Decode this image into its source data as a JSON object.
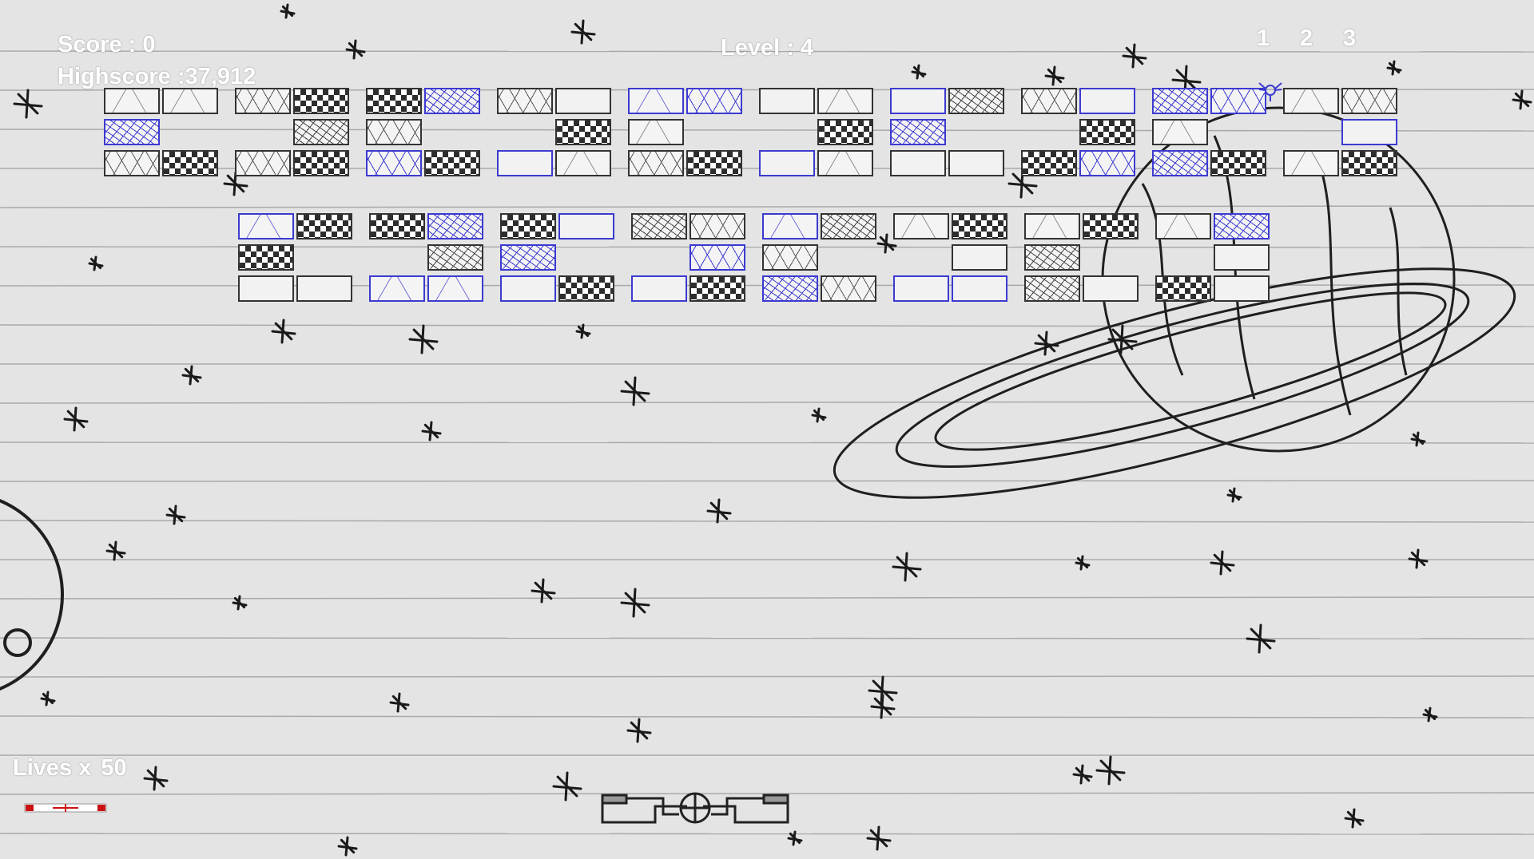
{
  "hud": {
    "score_label": "Score : 0",
    "highscore_label": "Highscore :37,912",
    "level_label": "Level : 4",
    "lives_label": "Lives x",
    "lives_value": "50",
    "ball_select": [
      "1",
      "2",
      "3"
    ]
  },
  "colors": {
    "paper": "#e4e4e4",
    "ruled_line": "#a9a9a9",
    "ink": "#1f1f1f",
    "blue_brick": "#3c3ad0",
    "hud_text": "#ffffff",
    "lives_icon_accent": "#cc1111"
  },
  "icons": {
    "lives": "paddle-lives-icon",
    "paddle": "sketch-paddle",
    "ball": "winged-ball-icon"
  },
  "bricks": {
    "top_group_1": [
      [
        "light",
        "light",
        "scratch",
        "checker",
        "checker",
        "crack-blue",
        "scratch",
        "plain",
        "light-blue",
        "scratch-blue",
        "plain",
        "light",
        "plain-blue",
        "crack",
        "scratch",
        "plain-blue",
        "crack-blue",
        "scratch-blue",
        "light",
        "scratch"
      ],
      [
        "crack-blue",
        "",
        "",
        "crack",
        "scratch",
        "",
        "",
        "checker",
        "light",
        "",
        "",
        "checker",
        "crack-blue",
        "",
        "",
        "checker",
        "light",
        "",
        "",
        "plain-blue"
      ],
      [
        "scratch",
        "checker",
        "scratch",
        "checker",
        "scratch-blue",
        "checker",
        "plain-blue",
        "light",
        "scratch",
        "checker",
        "plain-blue",
        "light",
        "plain",
        "plain",
        "checker",
        "scratch-blue",
        "crack-blue",
        "checker",
        "light",
        "checker"
      ]
    ],
    "top_group_2": [
      [
        "light-blue",
        "checker",
        "checker",
        "crack-blue",
        "checker",
        "plain-blue",
        "crack",
        "scratch",
        "light-blue",
        "crack",
        "light",
        "checker",
        "light",
        "checker",
        "light",
        "crack-blue"
      ],
      [
        "checker",
        "",
        "",
        "crack",
        "crack-blue",
        "",
        "",
        "scratch-blue",
        "scratch",
        "",
        "",
        "plain",
        "crack",
        "",
        "",
        "plain"
      ],
      [
        "plain",
        "plain",
        "light-blue",
        "light-blue",
        "plain-blue",
        "checker",
        "plain-blue",
        "checker",
        "crack-blue",
        "scratch",
        "plain-blue",
        "plain-blue",
        "crack",
        "plain",
        "checker",
        "plain"
      ]
    ]
  }
}
